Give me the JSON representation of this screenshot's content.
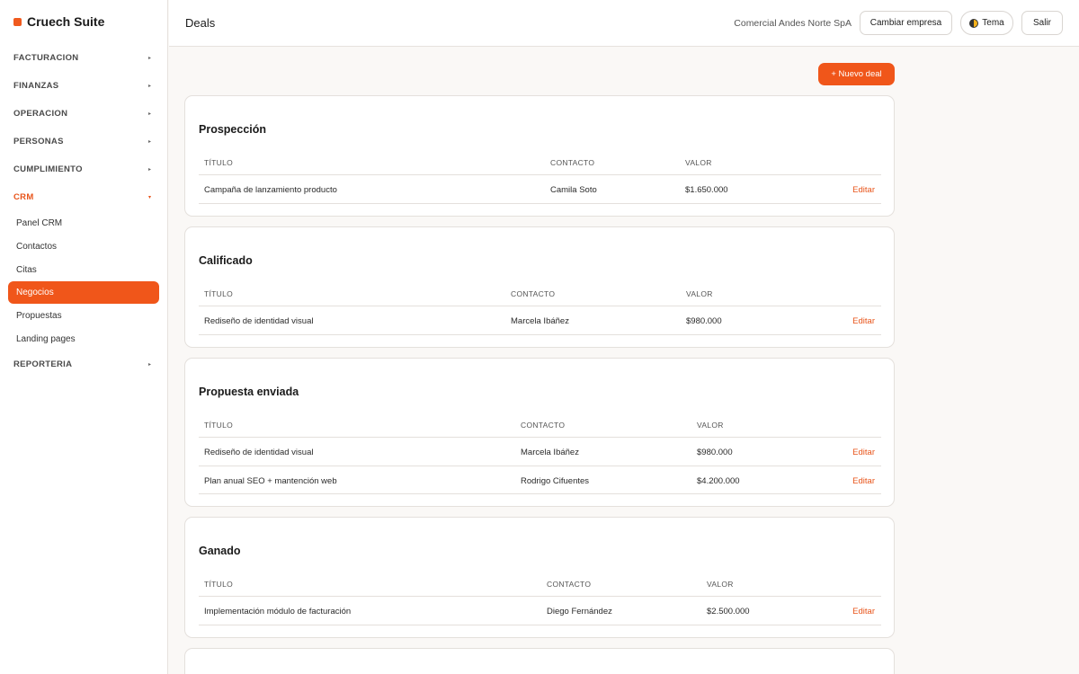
{
  "app": {
    "name": "Cruech Suite"
  },
  "sidebar": {
    "sections": [
      {
        "label": "FACTURACION",
        "caret": "▸"
      },
      {
        "label": "FINANZAS",
        "caret": "▸"
      },
      {
        "label": "OPERACION",
        "caret": "▸"
      },
      {
        "label": "PERSONAS",
        "caret": "▸"
      },
      {
        "label": "CUMPLIMIENTO",
        "caret": "▸"
      },
      {
        "label": "CRM",
        "caret": "▾"
      },
      {
        "label": "REPORTERIA",
        "caret": "▸"
      }
    ],
    "crm_items": [
      {
        "label": "Panel CRM"
      },
      {
        "label": "Contactos"
      },
      {
        "label": "Citas"
      },
      {
        "label": "Negocios"
      },
      {
        "label": "Propuestas"
      },
      {
        "label": "Landing pages"
      }
    ]
  },
  "header": {
    "title": "Deals",
    "company": "Comercial Andes Norte SpA",
    "change_company": "Cambiar empresa",
    "theme": "Tema",
    "logout": "Salir"
  },
  "actions": {
    "new_deal": "+ Nuevo deal"
  },
  "stages": [
    {
      "title": "Prospección",
      "columns": {
        "title": "TÍTULO",
        "contact": "CONTACTO",
        "value": "VALOR"
      },
      "rows": [
        {
          "title": "Campaña de lanzamiento producto",
          "contact": "Camila Soto",
          "value": "$1.650.000",
          "action": "Editar"
        }
      ]
    },
    {
      "title": "Calificado",
      "columns": {
        "title": "TÍTULO",
        "contact": "CONTACTO",
        "value": "VALOR"
      },
      "rows": [
        {
          "title": "Rediseño de identidad visual",
          "contact": "Marcela Ibáñez",
          "value": "$980.000",
          "action": "Editar"
        }
      ]
    },
    {
      "title": "Propuesta enviada",
      "columns": {
        "title": "TÍTULO",
        "contact": "CONTACTO",
        "value": "VALOR"
      },
      "rows": [
        {
          "title": "Rediseño de identidad visual",
          "contact": "Marcela Ibáñez",
          "value": "$980.000",
          "action": "Editar"
        },
        {
          "title": "Plan anual SEO + mantención web",
          "contact": "Rodrigo Cifuentes",
          "value": "$4.200.000",
          "action": "Editar"
        }
      ]
    },
    {
      "title": "Ganado",
      "columns": {
        "title": "TÍTULO",
        "contact": "CONTACTO",
        "value": "VALOR"
      },
      "rows": [
        {
          "title": "Implementación módulo de facturación",
          "contact": "Diego Fernández",
          "value": "$2.500.000",
          "action": "Editar"
        }
      ]
    }
  ],
  "colors": {
    "accent": "#f0561a",
    "accent_text": "#e8541a",
    "background": "#faf8f6"
  }
}
